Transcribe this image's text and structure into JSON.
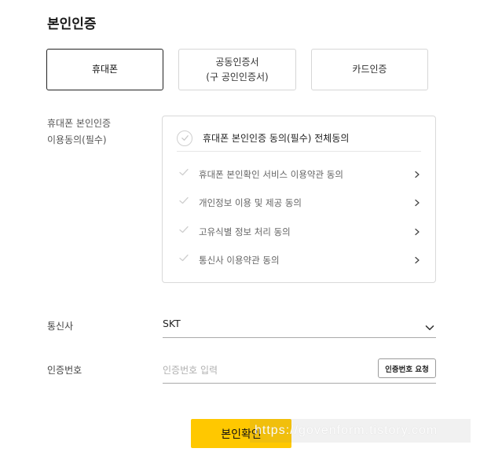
{
  "page": {
    "title": "본인인증"
  },
  "methods": [
    {
      "line1": "휴대폰",
      "line2": "",
      "active": true
    },
    {
      "line1": "공동인증서",
      "line2": "(구 공인인증서)",
      "active": false
    },
    {
      "line1": "카드인증",
      "line2": "",
      "active": false
    }
  ],
  "agreement": {
    "label_line1": "휴대폰 본인인증",
    "label_line2": "이용동의(필수)",
    "all": "휴대폰 본인인증 동의(필수) 전체동의",
    "items": [
      "휴대폰 본인확인 서비스 이용약관 동의",
      "개인정보 이용 및 제공 동의",
      "고유식별 정보 처리 동의",
      "통신사 이용약관 동의"
    ]
  },
  "carrier": {
    "label": "통신사",
    "value": "SKT"
  },
  "code": {
    "label": "인증번호",
    "placeholder": "인증번호 입력",
    "request_label": "인증번호 요청"
  },
  "confirm": {
    "label": "본인확인"
  },
  "watermark": {
    "text": "https://govenform.tistory.com"
  },
  "colors": {
    "accent": "#ffc800",
    "border": "#d9d9d9",
    "active_border": "#222222"
  },
  "icons": {
    "agree_all": "circle-check-icon",
    "agree_item": "check-icon",
    "item_arrow": "chevron-right-icon",
    "select_arrow": "chevron-down-icon"
  }
}
